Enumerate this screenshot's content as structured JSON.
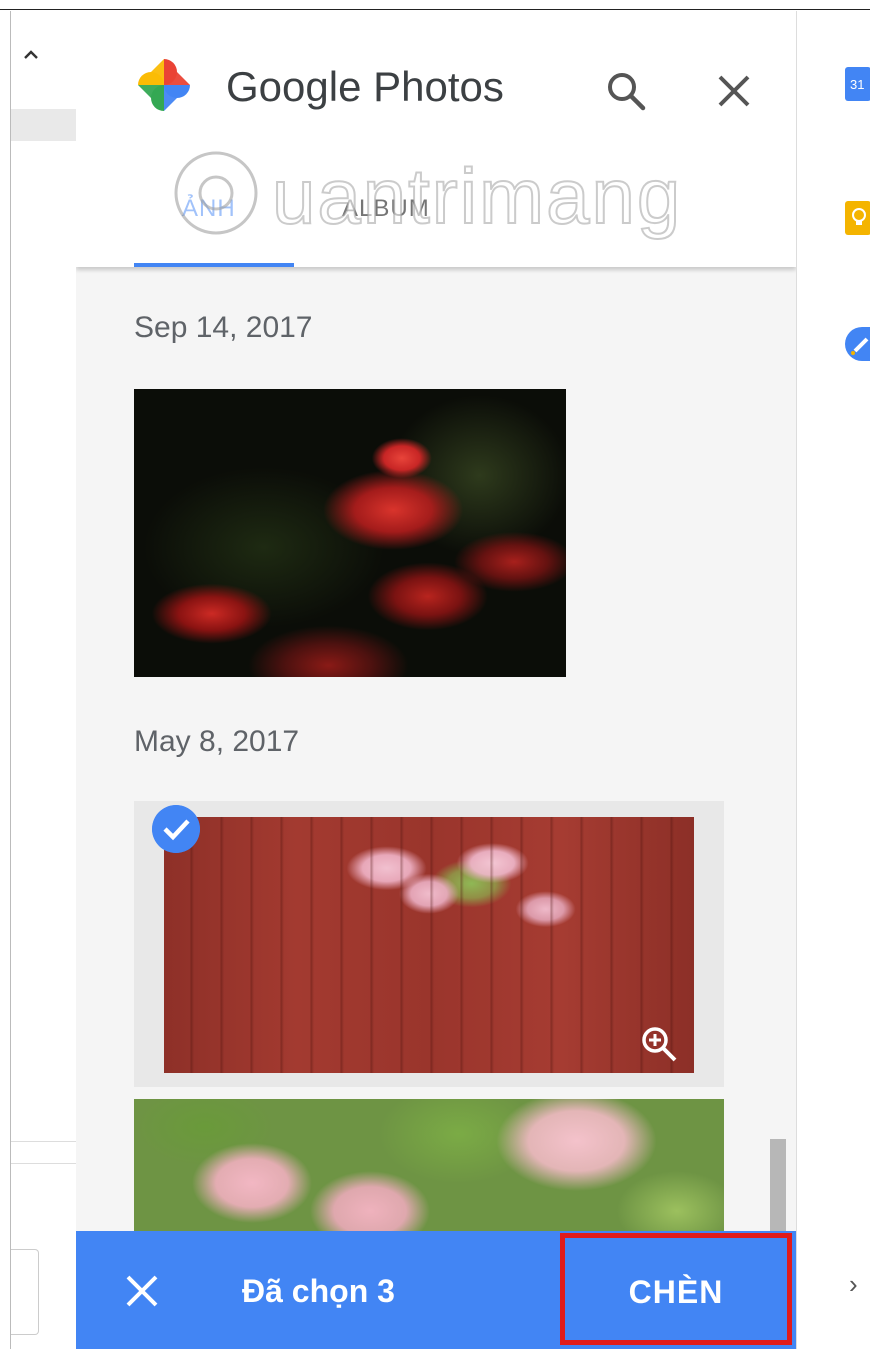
{
  "panel": {
    "title": "Google Photos",
    "tabs": [
      {
        "label": "ẢNH",
        "active": true
      },
      {
        "label": "ALBUM",
        "active": false
      }
    ]
  },
  "watermark": {
    "text": "uantrimang"
  },
  "photo_groups": [
    {
      "date": "Sep 14, 2017",
      "photos": [
        {
          "subject": "red spider lily flowers",
          "selected": false
        }
      ]
    },
    {
      "date": "May 8, 2017",
      "photos": [
        {
          "subject": "pink cherry blossoms by red wall",
          "selected": true
        },
        {
          "subject": "pink cherry blossoms with leaves",
          "selected": false
        }
      ]
    }
  ],
  "action_bar": {
    "selected_text": "Đã chọn 3",
    "insert_label": "CHÈN"
  },
  "colors": {
    "accent": "#4285f4",
    "highlight_box": "#e01b1b"
  },
  "icons": [
    "google-photos-logo",
    "search-icon",
    "close-icon",
    "check-icon",
    "zoom-in-icon",
    "calendar-icon",
    "keep-icon",
    "tasks-icon",
    "chevron-right-icon",
    "chevron-up-icon"
  ]
}
